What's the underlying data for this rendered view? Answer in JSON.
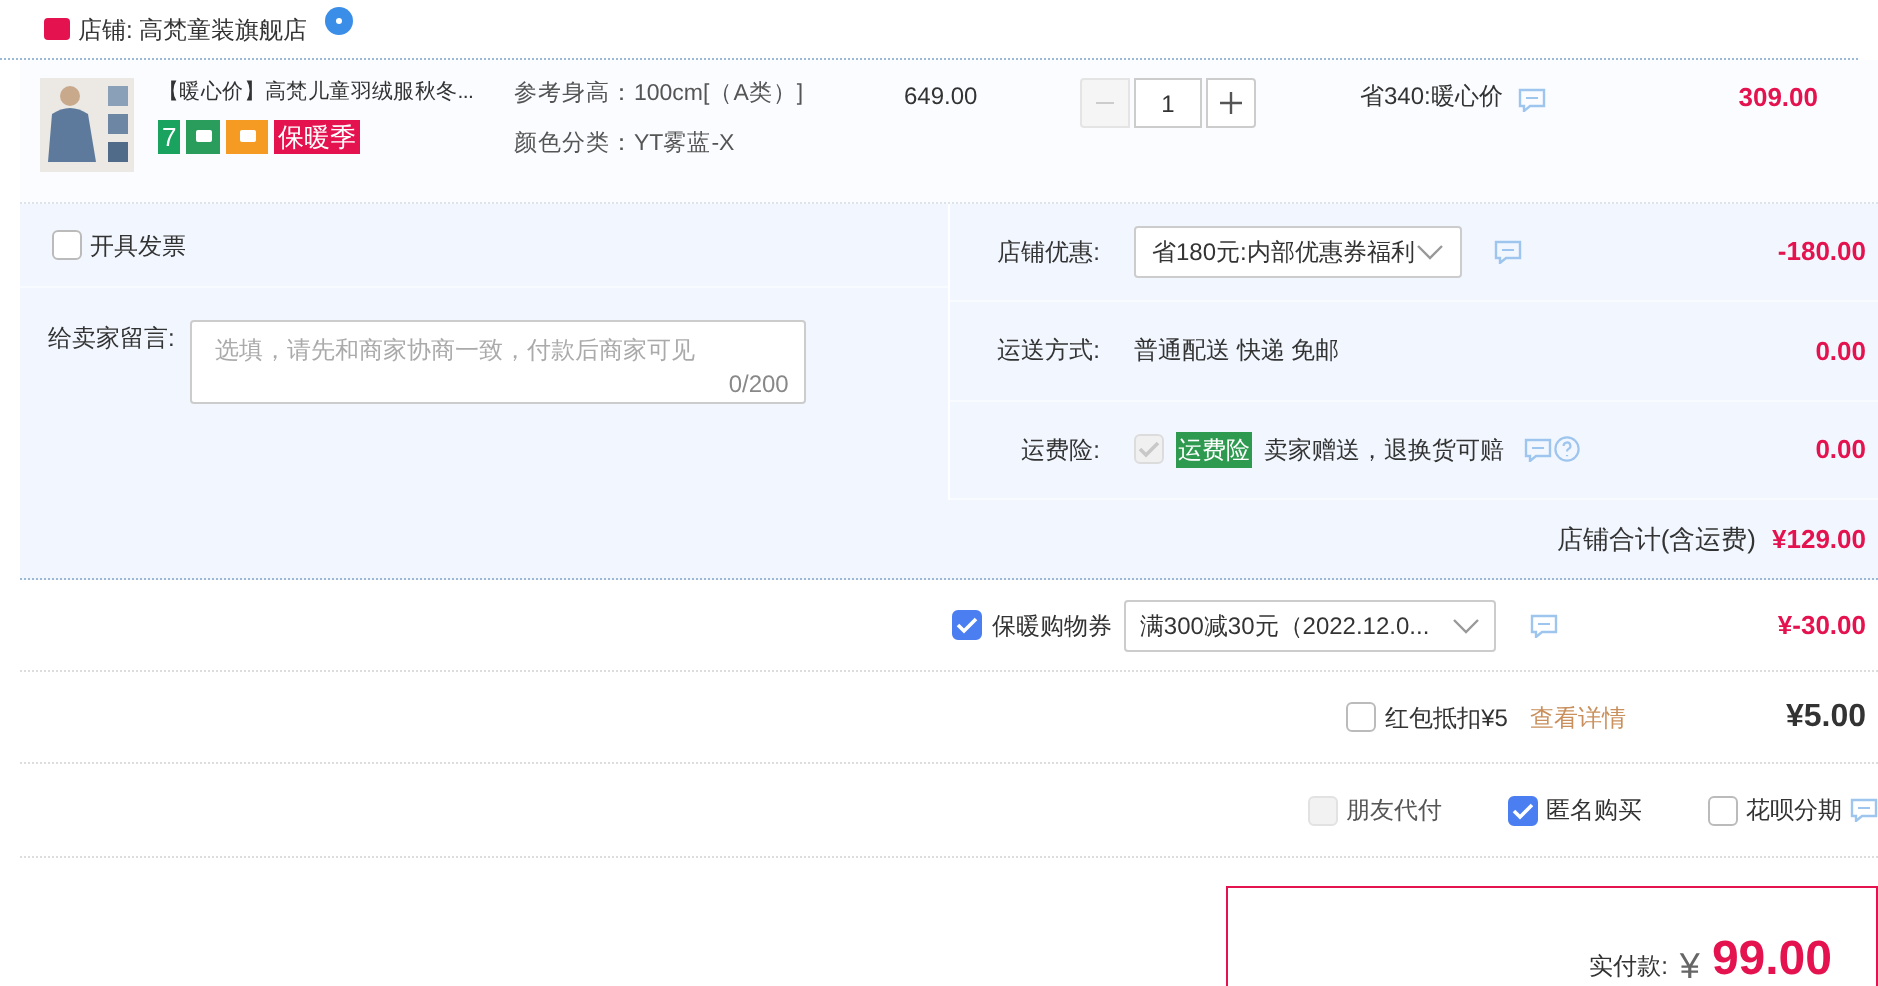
{
  "shop": {
    "label": "店铺: 高梵童装旗舰店"
  },
  "item": {
    "title": "【暖心价】高梵儿童羽绒服秋冬...",
    "badges": [
      {
        "kind": "text",
        "text": "7",
        "color": "#1aa35f"
      },
      {
        "kind": "icon",
        "color": "#2a9d5c"
      },
      {
        "kind": "icon",
        "color": "#f59a23"
      },
      {
        "kind": "text",
        "text": "保暖季",
        "color": "#e4134f"
      }
    ],
    "specs": [
      "参考身高：100cm[（A类）]",
      "颜色分类：YT雾蓝-X"
    ],
    "price": "649.00",
    "quantity": "1",
    "minus_disabled": true,
    "promo": "省340:暖心价",
    "subtotal": "309.00"
  },
  "invoice": {
    "label": "开具发票",
    "checked": false
  },
  "message": {
    "label": "给卖家留言:",
    "placeholder": "选填，请先和商家协商一致，付款后商家可见",
    "counter": "0/200"
  },
  "shop_rows": [
    {
      "kind": "select",
      "label": "店铺优惠:",
      "value": "省180元:内部优惠券福利",
      "amount": "-180.00"
    },
    {
      "kind": "text",
      "label": "运送方式:",
      "value": "普通配送 快递 免邮",
      "amount": "0.00"
    },
    {
      "kind": "insurance",
      "label": "运费险:",
      "checked": true,
      "disabled": true,
      "tag": "运费险",
      "value": "卖家赠送，退换货可赔",
      "amount": "0.00"
    }
  ],
  "shop_total": {
    "label": "店铺合计(含运费)",
    "value": "¥129.00"
  },
  "coupon": {
    "checked": true,
    "label": "保暖购物券",
    "value": "满300减30元（2022.12.0...",
    "amount": "¥-30.00"
  },
  "red_packet": {
    "checked": false,
    "label": "红包抵扣¥5",
    "link": "查看详情",
    "amount": "¥5.00"
  },
  "options": [
    {
      "label": "朋友代付",
      "checked": false,
      "disabled": true
    },
    {
      "label": "匿名购买",
      "checked": true,
      "disabled": false
    },
    {
      "label": "花呗分期",
      "checked": false,
      "disabled": false
    }
  ],
  "payment": {
    "label": "实付款:",
    "currency": "¥",
    "amount": "99.00"
  }
}
